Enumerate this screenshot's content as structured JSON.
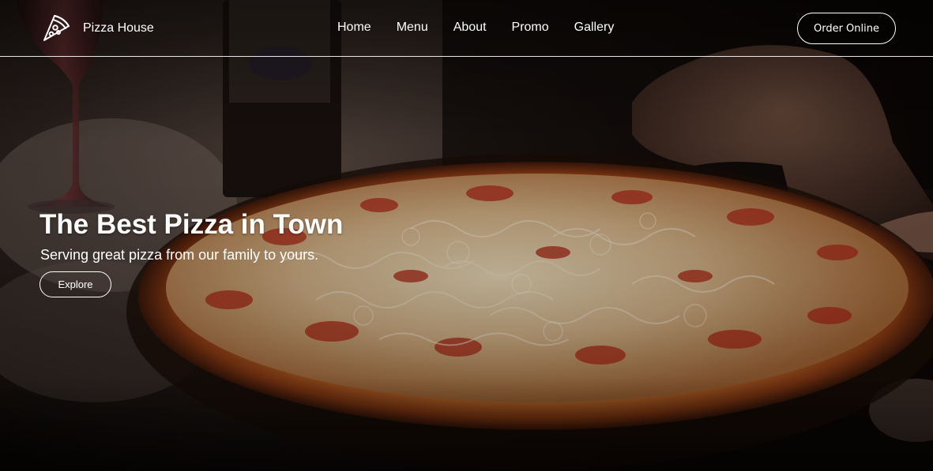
{
  "brand": {
    "name": "Pizza House",
    "logo_icon": "pizza-slice-icon"
  },
  "nav": {
    "items": [
      {
        "label": "Home"
      },
      {
        "label": "Menu"
      },
      {
        "label": "About"
      },
      {
        "label": "Promo"
      },
      {
        "label": "Gallery"
      }
    ],
    "order_label": "Order Online"
  },
  "hero": {
    "title": "The Best Pizza in Town",
    "subtitle": "Serving great pizza from our family to yours.",
    "button_label": "Explore",
    "background": "photo of a cheese and pepperoni pizza on a wooden board with a wine glass and bottle"
  },
  "colors": {
    "text": "#ffffff",
    "pizza_crust": "#9a4a1c",
    "cheese": "#e8cfa0",
    "pepperoni": "#b02a18",
    "background_dark": "#0d0806"
  }
}
